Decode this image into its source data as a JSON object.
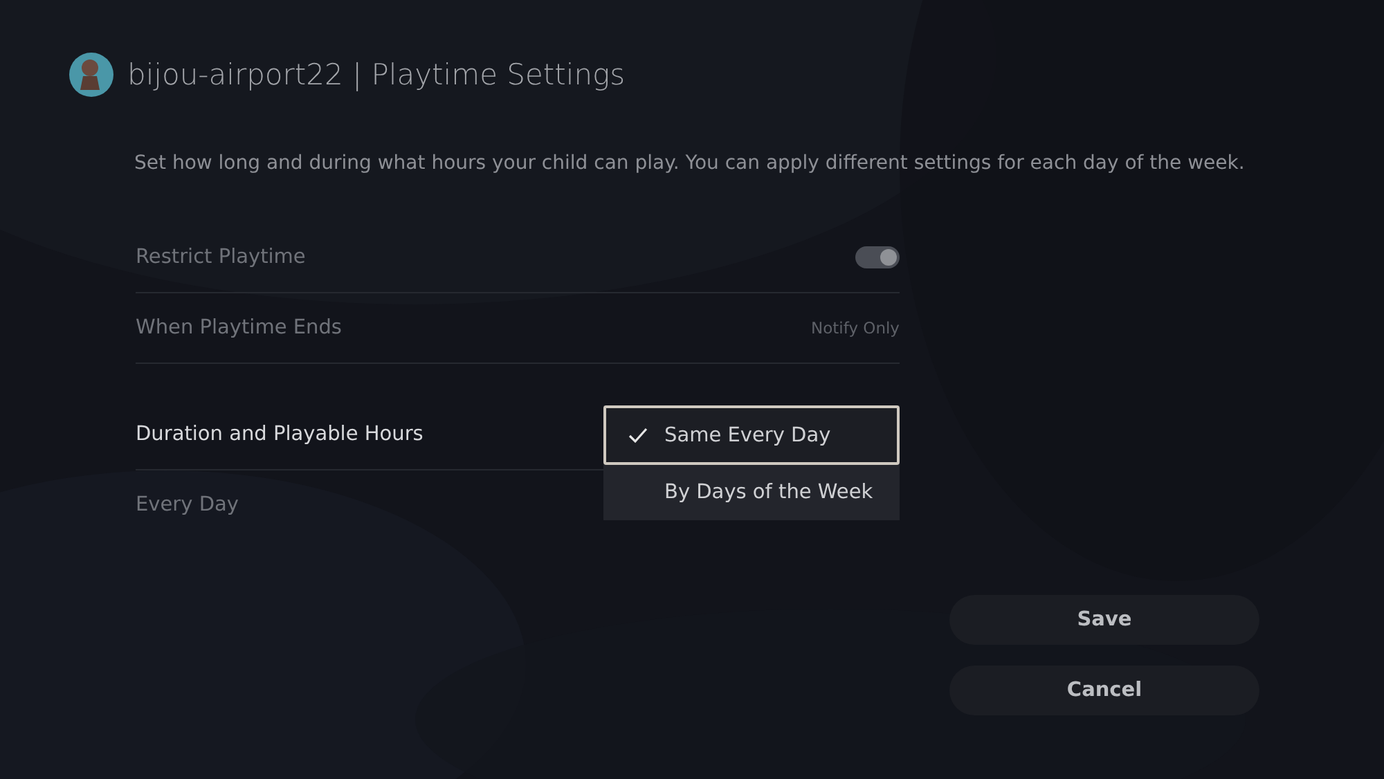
{
  "header": {
    "username": "bijou-airport22",
    "separator": "|",
    "title": "Playtime Settings"
  },
  "description": "Set how long and during what hours your child can play. You can apply different settings for each day of the week.",
  "rows": [
    {
      "kind": "toggle",
      "label": "Restrict Playtime",
      "on": true,
      "disabled": true
    },
    {
      "kind": "value",
      "label": "When Playtime Ends",
      "value": "Notify Only",
      "disabled": true
    },
    {
      "kind": "dropdown",
      "label": "Duration and Playable Hours",
      "disabled": false,
      "options": [
        {
          "label": "Same Every Day",
          "selected": true
        },
        {
          "label": "By Days of the Week",
          "selected": false
        }
      ]
    },
    {
      "kind": "plain",
      "label": "Every Day",
      "disabled": true
    }
  ],
  "buttons": [
    "Save",
    "Cancel"
  ]
}
